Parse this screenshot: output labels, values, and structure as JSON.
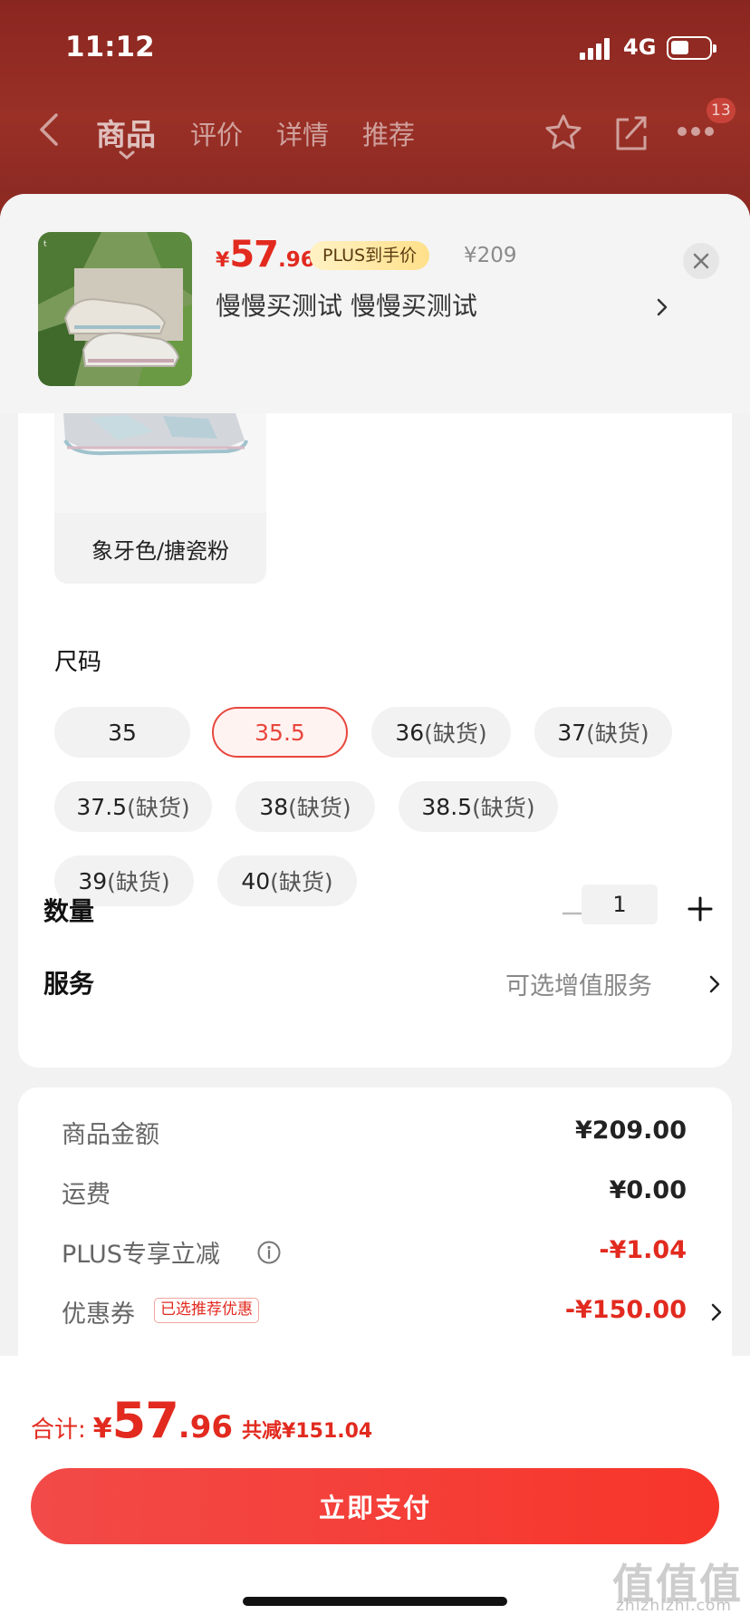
{
  "status_bar": {
    "time": "11:12",
    "network": "4G"
  },
  "nav": {
    "tabs": [
      "商品",
      "评价",
      "详情",
      "推荐"
    ],
    "active_tab": "商品",
    "badge_count": "13"
  },
  "product": {
    "price_symbol": "¥",
    "price_int": "57",
    "price_dec": ".96",
    "plus_badge": "PLUS到手价",
    "original_price": "¥209",
    "title": "慢慢买测试  慢慢买测试"
  },
  "color": {
    "selected_label": "象牙色/搪瓷粉"
  },
  "size": {
    "heading": "尺码",
    "options": [
      {
        "size": "35",
        "note": ""
      },
      {
        "size": "35.5",
        "note": ""
      },
      {
        "size": "36",
        "note": "(缺货)"
      },
      {
        "size": "37",
        "note": "(缺货)"
      },
      {
        "size": "37.5",
        "note": "(缺货)"
      },
      {
        "size": "38",
        "note": "(缺货)"
      },
      {
        "size": "38.5",
        "note": "(缺货)"
      },
      {
        "size": "39",
        "note": "(缺货)"
      },
      {
        "size": "40",
        "note": "(缺货)"
      }
    ],
    "selected": "35.5"
  },
  "quantity": {
    "label": "数量",
    "value": "1"
  },
  "service": {
    "label": "服务",
    "value": "可选增值服务"
  },
  "fees": {
    "goods_label": "商品金额",
    "goods_value": "¥209.00",
    "shipping_label": "运费",
    "shipping_value": "¥0.00",
    "plus_label": "PLUS专享立减",
    "plus_value": "-¥1.04",
    "coupon_label": "优惠券",
    "coupon_tag": "已选推荐优惠",
    "coupon_value": "-¥150.00"
  },
  "footer": {
    "total_label": "合计:",
    "total_symbol": "¥",
    "total_int": "57",
    "total_dec": ".96",
    "saved_text": "共减¥151.04",
    "pay_label": "立即支付"
  },
  "watermark": {
    "main": "值值值",
    "sub": "zhizhizhi.com"
  },
  "colors": {
    "accent": "#e22a1f",
    "header_bg": "#8e2a22"
  }
}
